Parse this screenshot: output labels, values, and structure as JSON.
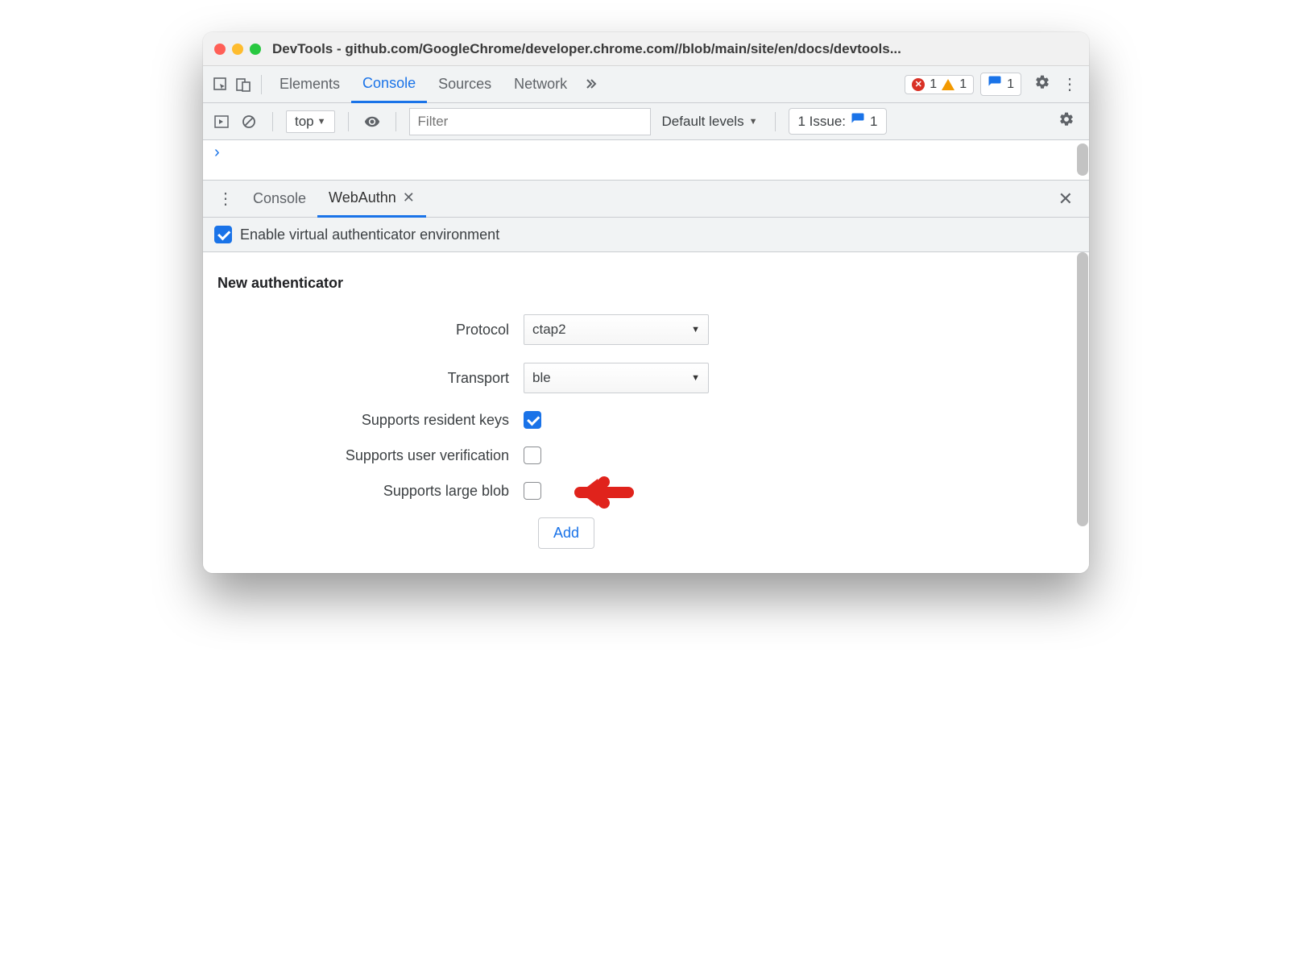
{
  "window": {
    "title": "DevTools - github.com/GoogleChrome/developer.chrome.com//blob/main/site/en/docs/devtools..."
  },
  "tabs": {
    "elements": "Elements",
    "console": "Console",
    "sources": "Sources",
    "network": "Network"
  },
  "counters": {
    "errors": "1",
    "warnings": "1",
    "issues": "1"
  },
  "console_toolbar": {
    "context": "top",
    "filter_placeholder": "Filter",
    "levels": "Default levels",
    "issue_text": "1 Issue:",
    "issue_count": "1"
  },
  "drawer": {
    "console": "Console",
    "webauthn": "WebAuthn"
  },
  "enable_label": "Enable virtual authenticator environment",
  "section_title": "New authenticator",
  "form": {
    "protocol_label": "Protocol",
    "protocol_value": "ctap2",
    "transport_label": "Transport",
    "transport_value": "ble",
    "resident_label": "Supports resident keys",
    "userver_label": "Supports user verification",
    "largeblob_label": "Supports large blob",
    "add_label": "Add"
  }
}
